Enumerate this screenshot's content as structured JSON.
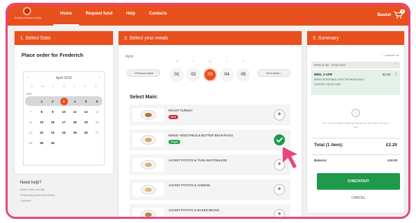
{
  "app": {
    "logo_text": "Reading Hampers Meals",
    "nav": [
      "Home",
      "Request fund",
      "Help",
      "Contacts"
    ],
    "basket_label": "Basket",
    "basket_count": "1"
  },
  "colors": {
    "brand": "#e8501e",
    "success": "#1f9a4a",
    "frame": "#e8457f"
  },
  "select_date": {
    "header": "1. Select Date",
    "title": "Place order for Frederich",
    "calendar": {
      "month": "April 2019",
      "prev_icon": "chevron-left-icon",
      "next_icon": "chevron-right-icon",
      "dow": [
        "S",
        "M",
        "T",
        "W",
        "T",
        "F",
        "S"
      ],
      "month_label": "APR",
      "weeks": [
        [
          "",
          "1",
          "2",
          "3",
          "4",
          "5",
          "6"
        ],
        [
          "7",
          "8",
          "9",
          "10",
          "11",
          "12",
          "13"
        ],
        [
          "14",
          "15",
          "16",
          "17",
          "18",
          "19",
          "20"
        ],
        [
          "21",
          "22",
          "23",
          "24",
          "25",
          "26",
          "27"
        ],
        [
          "28",
          "29",
          "30",
          "",
          "",
          "",
          ""
        ]
      ],
      "selected_day": "3"
    },
    "help": {
      "title": "Need help?",
      "links": [
        "Watch video tutorial",
        "Frequently Asked Questions",
        "Contacts"
      ]
    }
  },
  "select_meals": {
    "header": "2. Select your meals",
    "week_label": "April",
    "prev_week": "Previous week",
    "next_week": "Next week",
    "days": [
      {
        "letter": "M",
        "num": "01"
      },
      {
        "letter": "T",
        "num": "02"
      },
      {
        "letter": "W",
        "num": "03"
      },
      {
        "letter": "T",
        "num": "04"
      },
      {
        "letter": "F",
        "num": "05"
      }
    ],
    "selected_day_index": 2,
    "section": "Select Main:",
    "meals": [
      {
        "name": "ROAST TURKEY",
        "badge": "Meat",
        "badge_color": "#d03030",
        "selected": false
      },
      {
        "name": "MIXED VEGETABLE & BUTTER BEAN RAGU",
        "badge": "Veggie",
        "badge_color": "#2aa14f",
        "selected": true
      },
      {
        "name": "JACKET POTATO & TUNA MAYONNAISE",
        "badge": "",
        "selected": false
      },
      {
        "name": "JACKET POTATO & CHEESE",
        "badge": "",
        "selected": false
      },
      {
        "name": "JACKET POTATO & BAKED BEANS",
        "badge": "",
        "selected": false
      }
    ]
  },
  "summary": {
    "header": "3. Summary",
    "collapse": "Collapse all",
    "week_range": "Week 01 Apr - 05 Apr 2019",
    "item": {
      "date": "WED, 3 APR",
      "price": "£2.20",
      "line1": "MIXED VEGETABLE & BUTTER BEAN RAGU",
      "line2": "XXXFRUIT SELECTION"
    },
    "empty_text": "You can continue ordering dishes for the week on your left",
    "total_label": "Total (1 item):",
    "total_value": "£2.20",
    "balance_label": "Balance:",
    "balance_value": "£10.20",
    "checkout": "CHECKOUT",
    "cancel": "CANCEL"
  }
}
